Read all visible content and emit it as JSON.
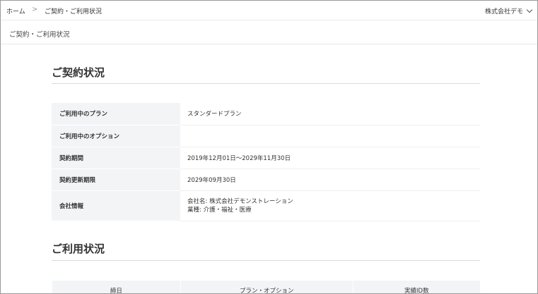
{
  "breadcrumb": {
    "home": "ホーム",
    "separator": ">",
    "current": "ご契約・ご利用状況"
  },
  "header": {
    "company": "株式会社デモ",
    "company_icon": "chevron-down-icon"
  },
  "page": {
    "title": "ご契約・ご利用状況"
  },
  "contract": {
    "title": "ご契約状況",
    "rows": [
      {
        "label": "ご利用中のプラン",
        "value": "スタンダードプラン"
      },
      {
        "label": "ご利用中のオプション",
        "value": ""
      },
      {
        "label": "契約期間",
        "value": "2019年12月01日～2029年11月30日"
      },
      {
        "label": "契約更新期限",
        "value": "2029年09月30日"
      },
      {
        "label": "会社情報",
        "value_line1": "会社名: 株式会社デモンストレーション",
        "value_line2": "業種: 介護・福祉・医療"
      }
    ]
  },
  "usage": {
    "title": "ご利用状況",
    "columns": [
      "締日",
      "プラン・オプション",
      "実績ID数"
    ]
  },
  "colors": {
    "border": "#9a9a9a",
    "table_header_bg": "#f3f4f6",
    "text": "#333333"
  }
}
